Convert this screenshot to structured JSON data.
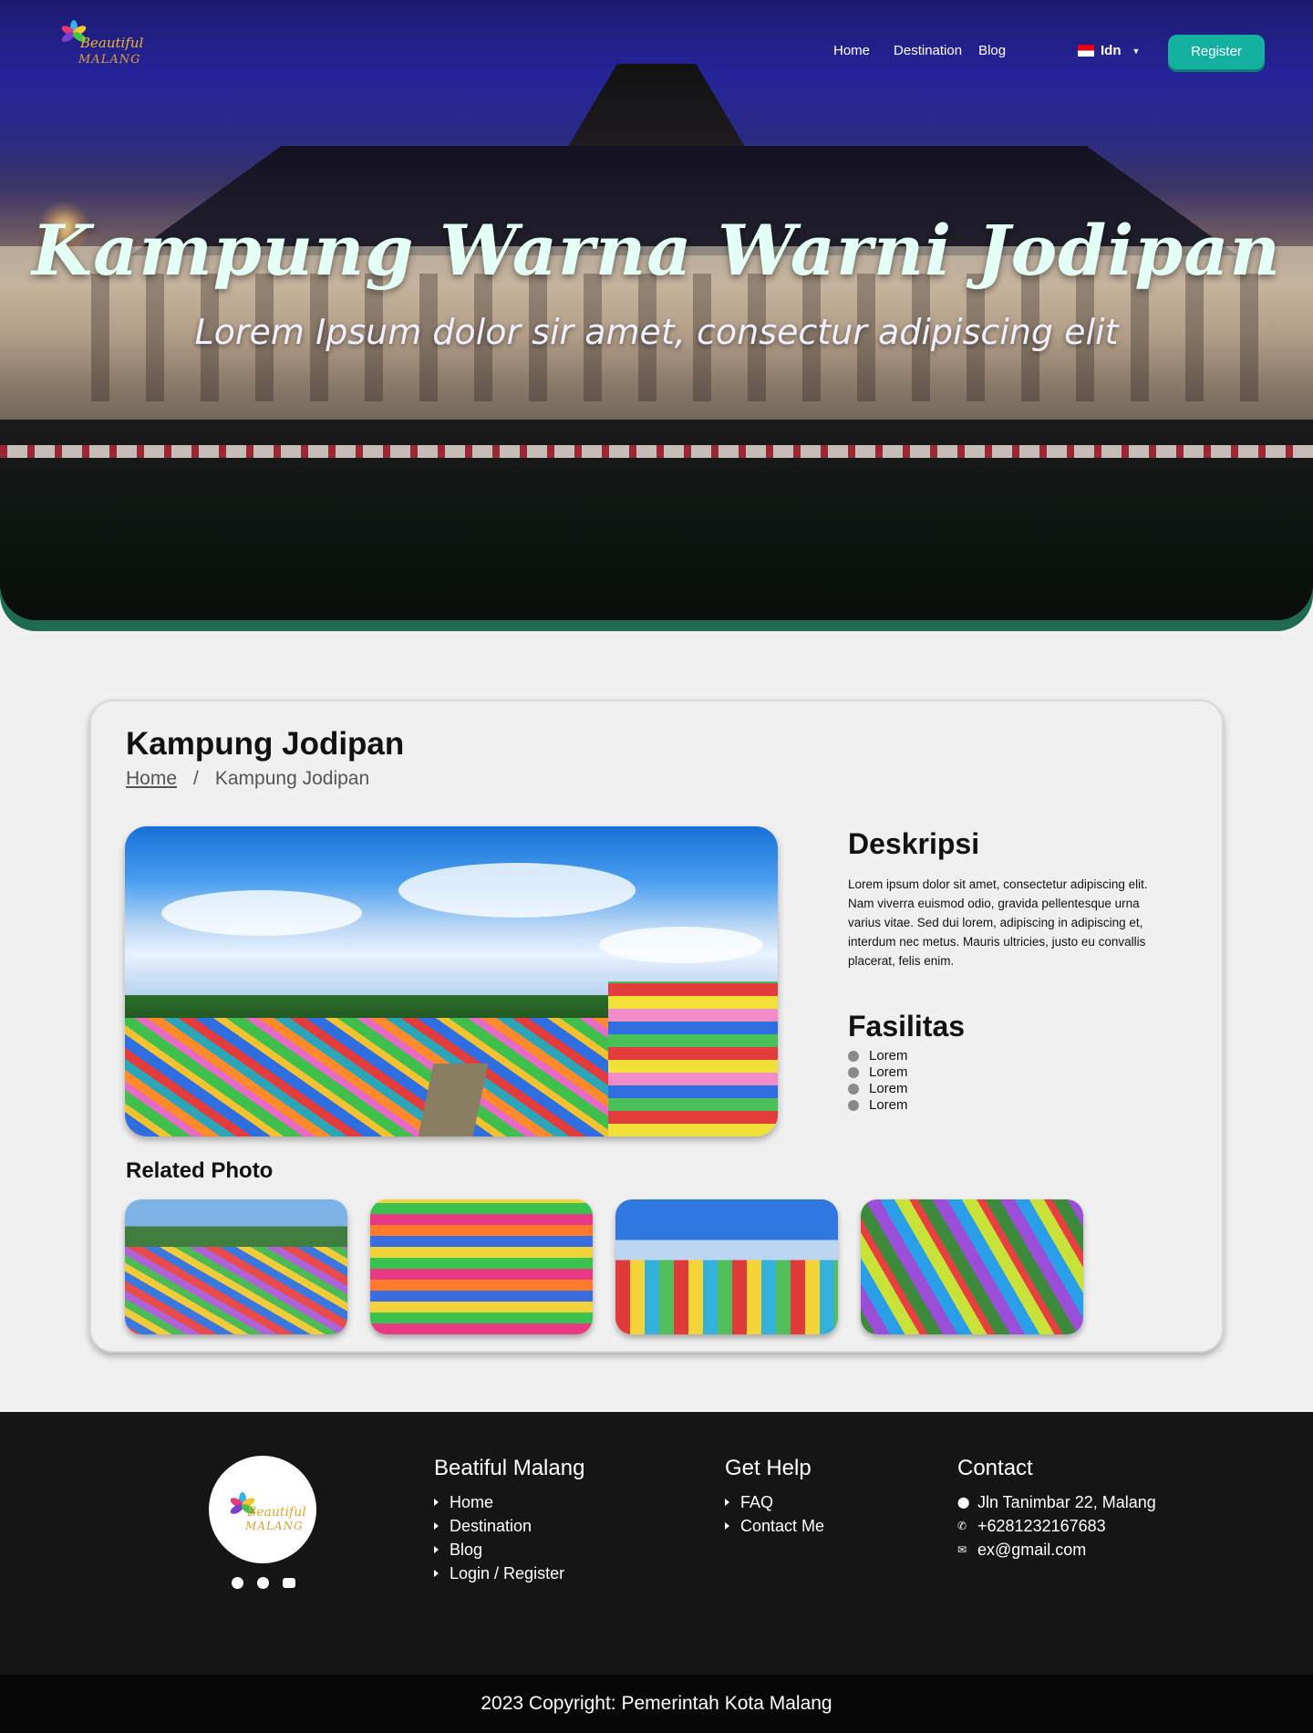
{
  "brand": {
    "line1": "Beautiful",
    "line2": "MALANG"
  },
  "nav": {
    "links": [
      "Home",
      "Destination",
      "Blog"
    ],
    "language": "Idn",
    "register": "Register"
  },
  "hero": {
    "title": "Kampung Warna Warni Jodipan",
    "subtitle": "Lorem Ipsum dolor sir amet, consectur adipiscing elit"
  },
  "detail": {
    "title": "Kampung Jodipan",
    "breadcrumb": {
      "home": "Home",
      "separator": "/",
      "current": "Kampung Jodipan"
    },
    "description_heading": "Deskripsi",
    "description": "Lorem ipsum dolor sit amet, consectetur adipiscing elit. Nam viverra euismod odio, gravida pellentesque urna varius vitae. Sed dui lorem, adipiscing in adipiscing et, interdum nec metus. Mauris ultricies, justo eu convallis placerat, felis enim.",
    "facilities_heading": "Fasilitas",
    "facilities": [
      "Lorem",
      "Lorem",
      "Lorem",
      "Lorem"
    ],
    "related_heading": "Related Photo"
  },
  "footer": {
    "social_icons": [
      "facebook-icon",
      "instagram-icon",
      "youtube-icon"
    ],
    "col1": {
      "heading": "Beatiful Malang",
      "links": [
        "Home",
        "Destination",
        "Blog",
        "Login / Register"
      ]
    },
    "col2": {
      "heading": "Get Help",
      "links": [
        "FAQ",
        "Contact Me"
      ]
    },
    "col3": {
      "heading": "Contact",
      "address": "Jln Tanimbar 22, Malang",
      "phone": "+6281232167683",
      "email": "ex@gmail.com"
    },
    "copyright": "2023 Copyright: Pemerintah Kota Malang"
  },
  "colors": {
    "accent": "#14b0a0",
    "footer_bg": "#151515",
    "hero_band": "#1f6b52"
  }
}
